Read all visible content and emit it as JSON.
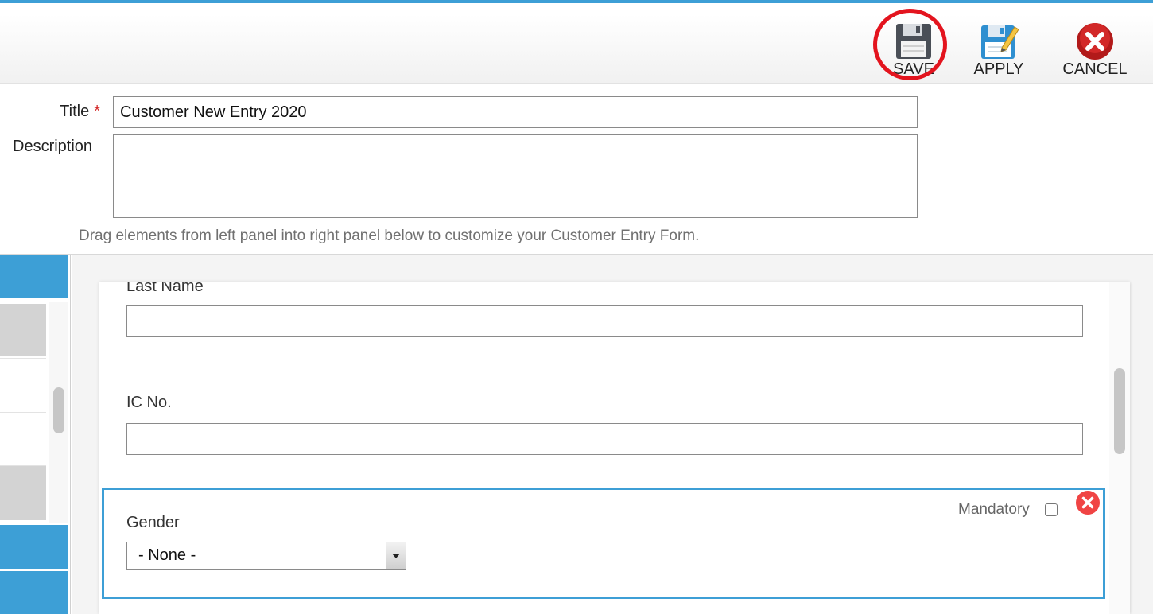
{
  "toolbar": {
    "save_label": "SAVE",
    "apply_label": "APPLY",
    "cancel_label": "CANCEL"
  },
  "form": {
    "title_label": "Title",
    "title_required_mark": "*",
    "title_value": "Customer New Entry 2020",
    "description_label": "Description",
    "description_value": "",
    "hint": "Drag elements from left panel into right panel below to customize your Customer Entry Form."
  },
  "builder": {
    "fields": [
      {
        "label": "Last Name",
        "value": ""
      },
      {
        "label": "IC No.",
        "value": ""
      }
    ],
    "selected_field": {
      "label": "Gender",
      "select_value": "- None -",
      "mandatory_label": "Mandatory",
      "mandatory_checked": false
    }
  },
  "colors": {
    "accent": "#3d9fd6",
    "highlight": "#e3141e",
    "remove": "#f04444"
  },
  "icons": {
    "save": "floppy-disk-icon",
    "apply": "floppy-disk-edit-icon",
    "cancel": "cancel-x-icon",
    "remove": "remove-x-icon"
  }
}
